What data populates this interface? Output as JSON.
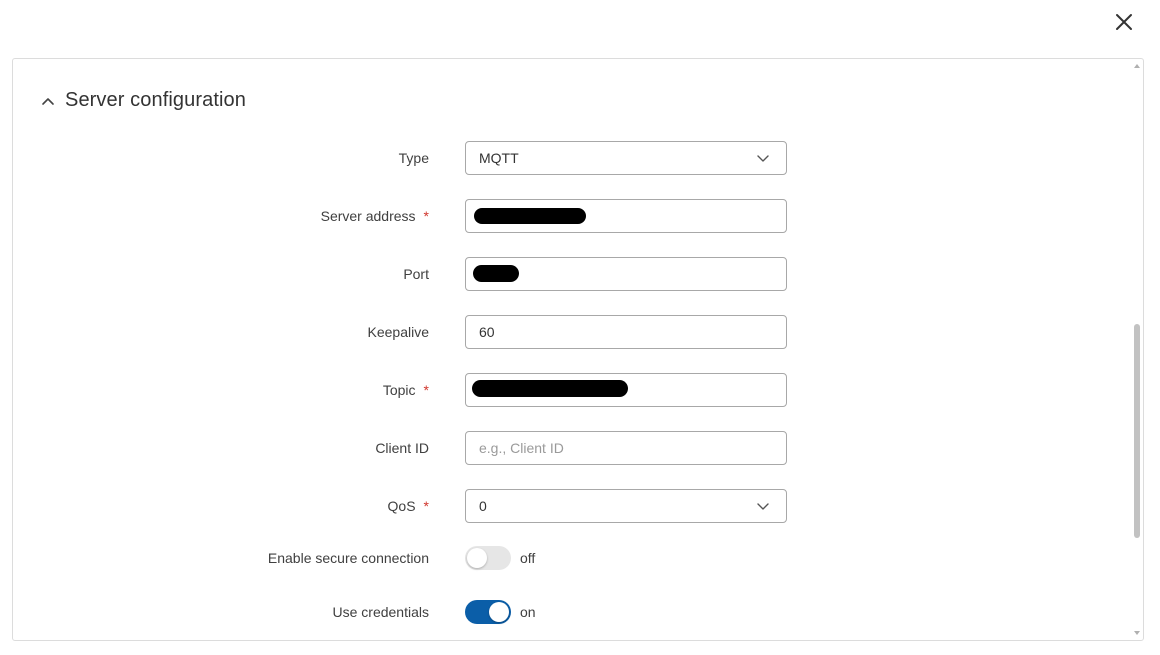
{
  "section": {
    "title": "Server configuration"
  },
  "fields": {
    "type": {
      "label": "Type",
      "value": "MQTT"
    },
    "server_address": {
      "label": "Server address",
      "required_mark": "*"
    },
    "port": {
      "label": "Port"
    },
    "keepalive": {
      "label": "Keepalive",
      "value": "60"
    },
    "topic": {
      "label": "Topic",
      "required_mark": "*"
    },
    "client_id": {
      "label": "Client ID",
      "placeholder": "e.g., Client ID",
      "value": ""
    },
    "qos": {
      "label": "QoS",
      "required_mark": "*",
      "value": "0"
    },
    "secure": {
      "label": "Enable secure connection",
      "state_text": "off"
    },
    "credentials": {
      "label": "Use credentials",
      "state_text": "on"
    }
  },
  "colors": {
    "accent": "#0b5ea8",
    "required": "#d0352c",
    "toggle_off": "#e6e6e6"
  },
  "icons": {
    "close": "close-icon",
    "collapse": "chevron-up-icon",
    "dropdown": "chevron-down-icon"
  }
}
